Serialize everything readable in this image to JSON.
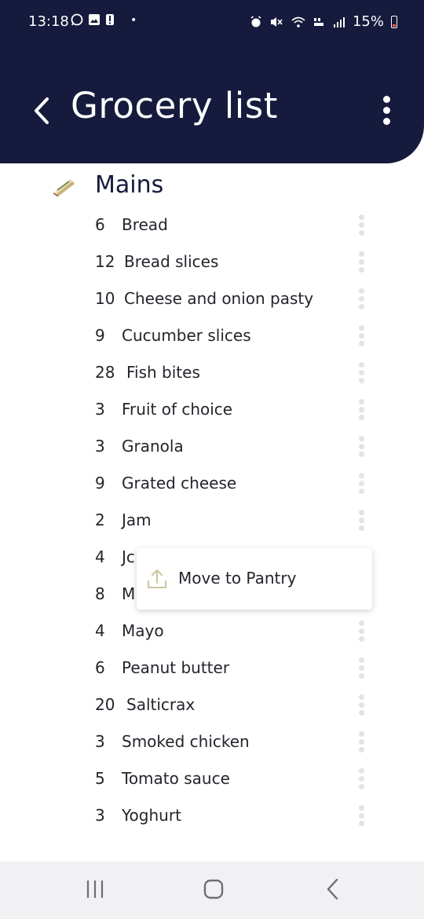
{
  "status_bar": {
    "time": "13:18",
    "battery": "15%",
    "dot": "•"
  },
  "header": {
    "title": "Grocery list",
    "back_icon": "chevron-left-icon",
    "menu_icon": "more-vertical-icon"
  },
  "section": {
    "title": "Mains",
    "icon": "sandwich-icon"
  },
  "items": [
    {
      "qty": "6",
      "name": "Bread"
    },
    {
      "qty": "12",
      "name": "Bread slices"
    },
    {
      "qty": "10",
      "name": "Cheese and onion pasty"
    },
    {
      "qty": "9",
      "name": "Cucumber slices"
    },
    {
      "qty": "28",
      "name": "Fish bites"
    },
    {
      "qty": "3",
      "name": "Fruit of choice"
    },
    {
      "qty": "3",
      "name": "Granola"
    },
    {
      "qty": "9",
      "name": "Grated cheese"
    },
    {
      "qty": "2",
      "name": "Jam"
    },
    {
      "qty": "4",
      "name": "Jc"
    },
    {
      "qty": "8",
      "name": "M"
    },
    {
      "qty": "4",
      "name": "Mayo"
    },
    {
      "qty": "6",
      "name": "Peanut butter"
    },
    {
      "qty": "20",
      "name": "Salticrax"
    },
    {
      "qty": "3",
      "name": "Smoked chicken"
    },
    {
      "qty": "5",
      "name": "Tomato sauce"
    },
    {
      "qty": "3",
      "name": "Yoghurt"
    }
  ],
  "popup": {
    "label": "Move to Pantry",
    "icon": "upload-icon"
  },
  "colors": {
    "header_bg": "#161a3c",
    "accent": "#c9c79a",
    "text": "#24242c"
  }
}
